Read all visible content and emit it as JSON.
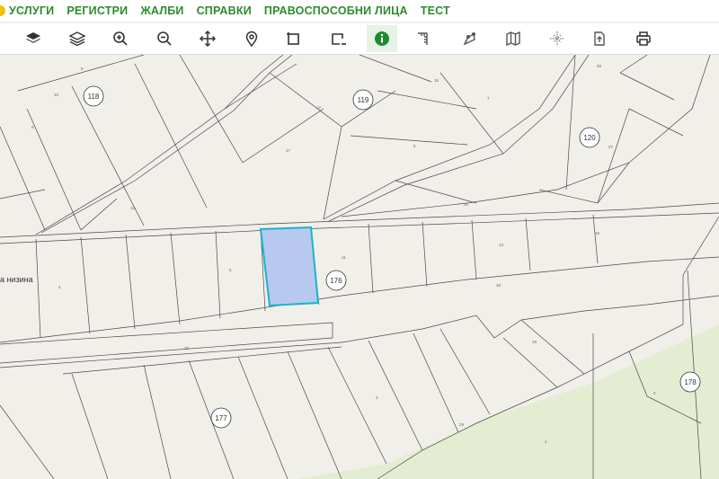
{
  "menu": {
    "items": [
      "УСЛУГИ",
      "РЕГИСТРИ",
      "ЖАЛБИ",
      "СПРАВКИ",
      "ПРАВОСПОСОБНИ ЛИЦА",
      "ТЕСТ"
    ]
  },
  "toolbar": {
    "tools": [
      {
        "name": "layers-filled-icon",
        "active": false
      },
      {
        "name": "layers-outline-icon",
        "active": false
      },
      {
        "name": "zoom-in-icon",
        "active": false
      },
      {
        "name": "zoom-out-icon",
        "active": false
      },
      {
        "name": "pan-icon",
        "active": false
      },
      {
        "name": "location-pin-icon",
        "active": false
      },
      {
        "name": "select-area-icon",
        "active": false
      },
      {
        "name": "deselect-area-icon",
        "active": false
      },
      {
        "name": "info-icon",
        "active": true
      },
      {
        "name": "measure-distance-icon",
        "active": false
      },
      {
        "name": "measure-area-icon",
        "active": false
      },
      {
        "name": "map-icon",
        "active": false
      },
      {
        "name": "coordinates-icon",
        "active": false
      },
      {
        "name": "export-icon",
        "active": false
      },
      {
        "name": "print-icon",
        "active": false
      }
    ],
    "active_color": "#1e8a2e"
  },
  "map": {
    "accent_color": "#2e8b2e",
    "highlight_fill": "#b7c9ee",
    "highlight_stroke": "#18b5c8",
    "green_zone_color": "#e4ecd2",
    "street_label": "а низина",
    "blocks": [
      "118",
      "119",
      "120",
      "176",
      "177",
      "178"
    ],
    "parcels": [
      "10",
      "9",
      "8",
      "13",
      "12",
      "15",
      "6",
      "7",
      "17",
      "26",
      "27",
      "20",
      "11",
      "14",
      "16",
      "18",
      "19",
      "25",
      "4",
      "5",
      "3",
      "2",
      "1",
      "29"
    ]
  }
}
